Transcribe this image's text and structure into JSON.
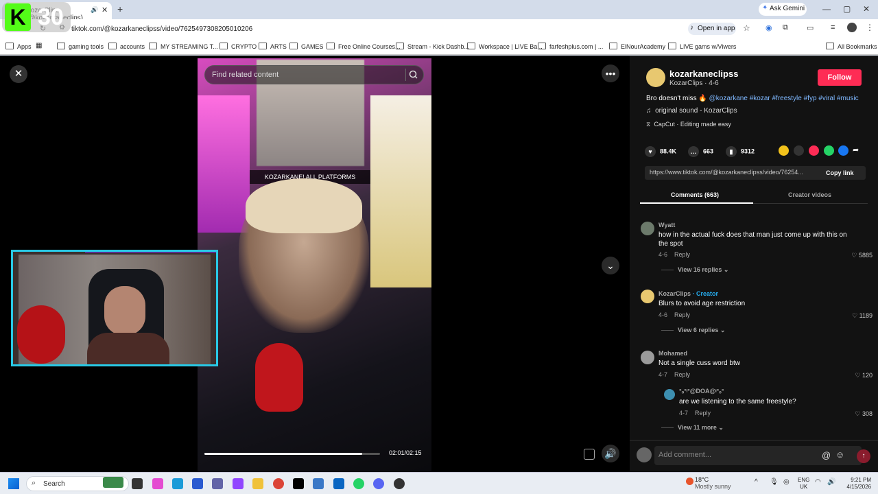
{
  "browser": {
    "tab_title": "KozarClips (@kozarkaneclips)",
    "ask_gemini": "Ask Gemini",
    "url": "tiktok.com/@kozarkaneclipss/video/7625497308205010206",
    "open_in_app": "Open in app",
    "bookmarks": [
      "Apps",
      "gaming tools",
      "accounts",
      "MY STREAMING T...",
      "CRYPTO",
      "ARTS",
      "GAMES",
      "Free Online Courses...",
      "Stream - Kick Dashb...",
      "Workspace | LIVE Ba...",
      "farfeshplus.com | ...",
      "ElNourAcademy",
      "LIVE gams w/Viwers"
    ],
    "all_bookmarks": "All Bookmarks"
  },
  "overlay": {
    "kick_letter": "K",
    "kick_count": "30"
  },
  "video": {
    "search_placeholder": "Find related content",
    "caption": "KOZARKANE! ALL PLATFORMS",
    "progress": 0.9,
    "timecode": "02:01/02:15"
  },
  "post": {
    "author_handle": "kozarkaneclipss",
    "author_sub": "KozarClips · 4-6",
    "follow_label": "Follow",
    "desc_text": "Bro doesn't miss 🔥",
    "desc_tags": "@kozarkane #kozar #freestyle #fyp #viral #music",
    "sound": "original sound - KozarClips",
    "capcut": "CapCut · Editing made easy",
    "likes": "88.4K",
    "comments": "663",
    "saves": "9312",
    "link": "https://www.tiktok.com/@kozarkaneclipss/video/76254...",
    "copy_link": "Copy link",
    "tab_comments": "Comments (663)",
    "tab_creator": "Creator videos"
  },
  "comments": [
    {
      "user": "Wyatt",
      "text": "how in the actual fuck does that man just come up with this on the spot",
      "date": "4-6",
      "reply": "Reply",
      "likes": "5885",
      "more": "View 16 replies"
    },
    {
      "user": "KozarClips",
      "creator": "· Creator",
      "text": "Blurs to avoid age restriction",
      "date": "4-6",
      "reply": "Reply",
      "likes": "1189",
      "more": "View 6 replies"
    },
    {
      "user": "Mohamed",
      "text": "Not a single cuss word btw",
      "date": "4-7",
      "reply": "Reply",
      "likes": "120"
    },
    {
      "user": "°ₒ°ᵎ°@DOA@ᵎ°ₒ°",
      "text": "are we listening to the same freestyle?",
      "date": "4-7",
      "reply": "Reply",
      "likes": "308",
      "more": "View 11 more"
    }
  ],
  "add_comment_placeholder": "Add comment...",
  "taskbar": {
    "search": "Search",
    "temp": "18°C",
    "weather": "Mostly sunny",
    "lang1": "ENG",
    "lang2": "UK",
    "time": "9:21 PM",
    "date": "4/15/2026"
  },
  "colors": {
    "follow": "#fe2c55",
    "webcam_border": "#29c9e6",
    "kick_green": "#53fc18",
    "creator_badge": "#27b1f5"
  }
}
